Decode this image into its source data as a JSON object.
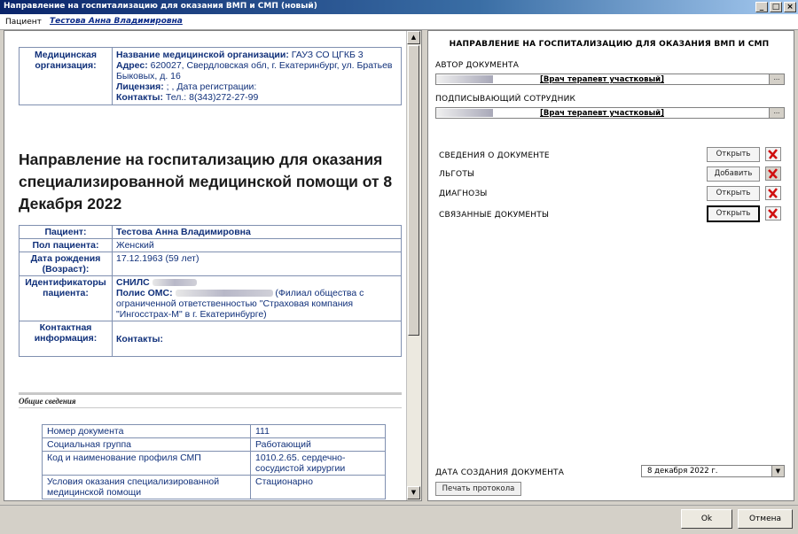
{
  "window": {
    "title": "Направление на госпитализацию для оказания ВМП и СМП (новый)"
  },
  "patient_bar": {
    "label": "Пациент",
    "name": "Тестова Анна Владимировна"
  },
  "document": {
    "org": {
      "header": "Медицинская организация:",
      "name_label": "Название медицинской организации:",
      "name_value": " ГАУЗ СО ЦГКБ 3",
      "address_label": "Адрес:",
      "address_value": " 620027, Свердловская обл, г. Екатеринбург, ул. Братьев Быковых, д. 16",
      "license_label": "Лицензия:",
      "license_value": " ; , Дата регистрации:",
      "contacts_label": "Контакты:",
      "contacts_value": " Тел.: 8(343)272-27-99"
    },
    "heading": "Направление на госпитализацию для оказания специализированной медицинской помощи от 8 Декабря 2022",
    "patient": {
      "patient_label": "Пациент:",
      "patient_value": "Тестова Анна Владимировна",
      "sex_label": "Пол пациента:",
      "sex_value": "Женский",
      "birth_label": "Дата рождения (Возраст):",
      "birth_value": "17.12.1963 (59 лет)",
      "ids_label": "Идентификаторы пациента:",
      "snils_label": "СНИЛС",
      "oms_label": "Полис ОМС:",
      "oms_value": "(Филиал общества с ограниченной ответственностью \"Страховая компания \"Ингосстрах-М\" в г. Екатеринбурге)",
      "contact_label": "Контактная информация:",
      "contact_value": "Контакты:"
    },
    "general_section": "Общие сведения",
    "general": [
      {
        "key": "Номер документа",
        "value": "111"
      },
      {
        "key": "Социальная группа",
        "value": "Работающий"
      },
      {
        "key": "Код и наименование профиля СМП",
        "value": "1010.2.65. сердечно-сосудистой хирургии"
      },
      {
        "key": "Условия оказания специализированной медицинской помощи",
        "value": "Стационарно"
      }
    ]
  },
  "right": {
    "title": "НАПРАВЛЕНИЕ НА ГОСПИТАЛИЗАЦИЮ ДЛЯ ОКАЗАНИЯ ВМП И СМП",
    "author_label": "АВТОР ДОКУМЕНТА",
    "author_position": "[Врач терапевт участковый]",
    "signer_label": "ПОДПИСЫВАЮЩИЙ СОТРУДНИК",
    "signer_position": "[Врач терапевт участковый]",
    "dots": "...",
    "rows": [
      {
        "label": "СВЕДЕНИЯ О ДОКУМЕНТЕ",
        "button": "Открыть"
      },
      {
        "label": "ЛЬГОТЫ",
        "button": "Добавить"
      },
      {
        "label": "ДИАГНОЗЫ",
        "button": "Открыть"
      },
      {
        "label": "СВЯЗАННЫЕ ДОКУМЕНТЫ",
        "button": "Открыть"
      }
    ],
    "date_label": "ДАТА СОЗДАНИЯ ДОКУМЕНТА",
    "date_value": "8 декабря  2022 г.",
    "print_button": "Печать протокола"
  },
  "footer": {
    "ok": "Ok",
    "cancel": "Отмена"
  }
}
